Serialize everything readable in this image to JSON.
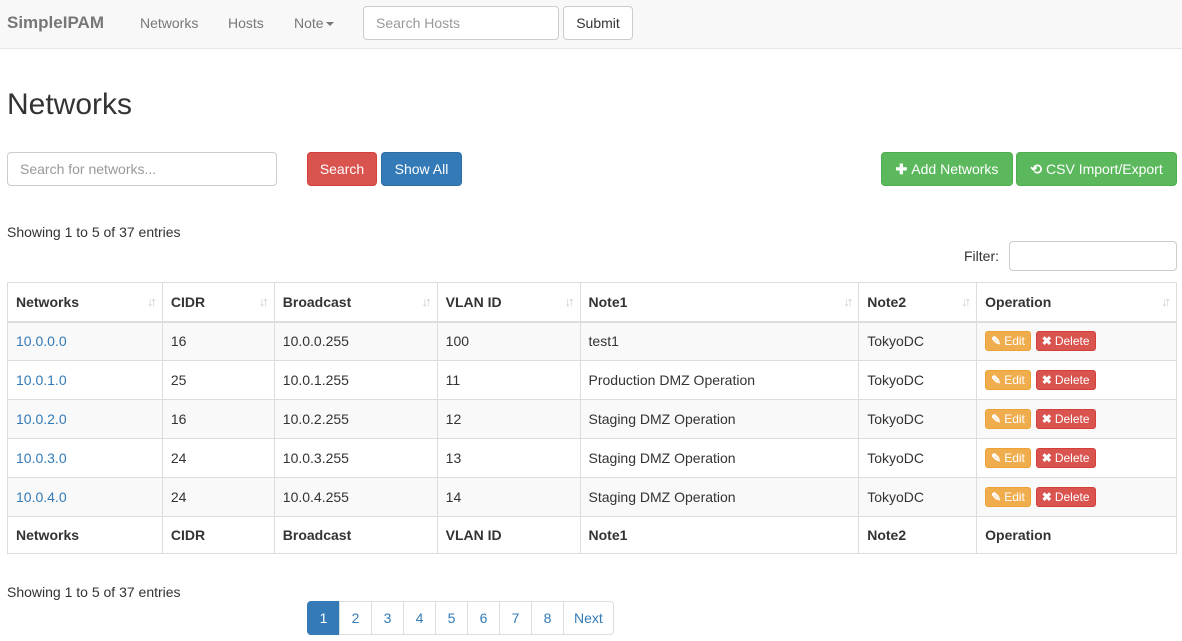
{
  "navbar": {
    "brand": "SimpleIPAM",
    "links": [
      "Networks",
      "Hosts",
      "Note"
    ],
    "search_placeholder": "Search Hosts",
    "submit_label": "Submit"
  },
  "page_title": "Networks",
  "toolbar": {
    "search_placeholder": "Search for networks...",
    "search_label": "Search",
    "show_all_label": "Show All",
    "add_label": "Add Networks",
    "csv_label": "CSV Import/Export"
  },
  "info_top": "Showing 1 to 5 of 37 entries",
  "info_bottom": "Showing 1 to 5 of 37 entries",
  "filter_label": "Filter:",
  "table": {
    "headers": [
      "Networks",
      "CIDR",
      "Broadcast",
      "VLAN ID",
      "Note1",
      "Note2",
      "Operation"
    ],
    "rows": [
      {
        "network": "10.0.0.0",
        "cidr": "16",
        "broadcast": "10.0.0.255",
        "vlan": "100",
        "note1": "test1",
        "note2": "TokyoDC"
      },
      {
        "network": "10.0.1.0",
        "cidr": "25",
        "broadcast": "10.0.1.255",
        "vlan": "11",
        "note1": "Production DMZ Operation",
        "note2": "TokyoDC"
      },
      {
        "network": "10.0.2.0",
        "cidr": "16",
        "broadcast": "10.0.2.255",
        "vlan": "12",
        "note1": "Staging DMZ Operation",
        "note2": "TokyoDC"
      },
      {
        "network": "10.0.3.0",
        "cidr": "24",
        "broadcast": "10.0.3.255",
        "vlan": "13",
        "note1": "Staging DMZ Operation",
        "note2": "TokyoDC"
      },
      {
        "network": "10.0.4.0",
        "cidr": "24",
        "broadcast": "10.0.4.255",
        "vlan": "14",
        "note1": "Staging DMZ Operation",
        "note2": "TokyoDC"
      }
    ],
    "edit_label": "Edit",
    "delete_label": "Delete"
  },
  "pagination": {
    "pages": [
      "1",
      "2",
      "3",
      "4",
      "5",
      "6",
      "7",
      "8"
    ],
    "active": "1",
    "next_label": "Next"
  },
  "colors": {
    "brand_text": "#777777",
    "primary": "#337ab7",
    "danger": "#d9534f",
    "success": "#5cb85c",
    "warning": "#f0ad4e"
  },
  "icons": {
    "caret": "caret-down-icon",
    "add": "plus-icon",
    "csv": "refresh-icon",
    "edit": "pencil-icon",
    "delete": "x-icon",
    "sort": "sort-icon"
  }
}
